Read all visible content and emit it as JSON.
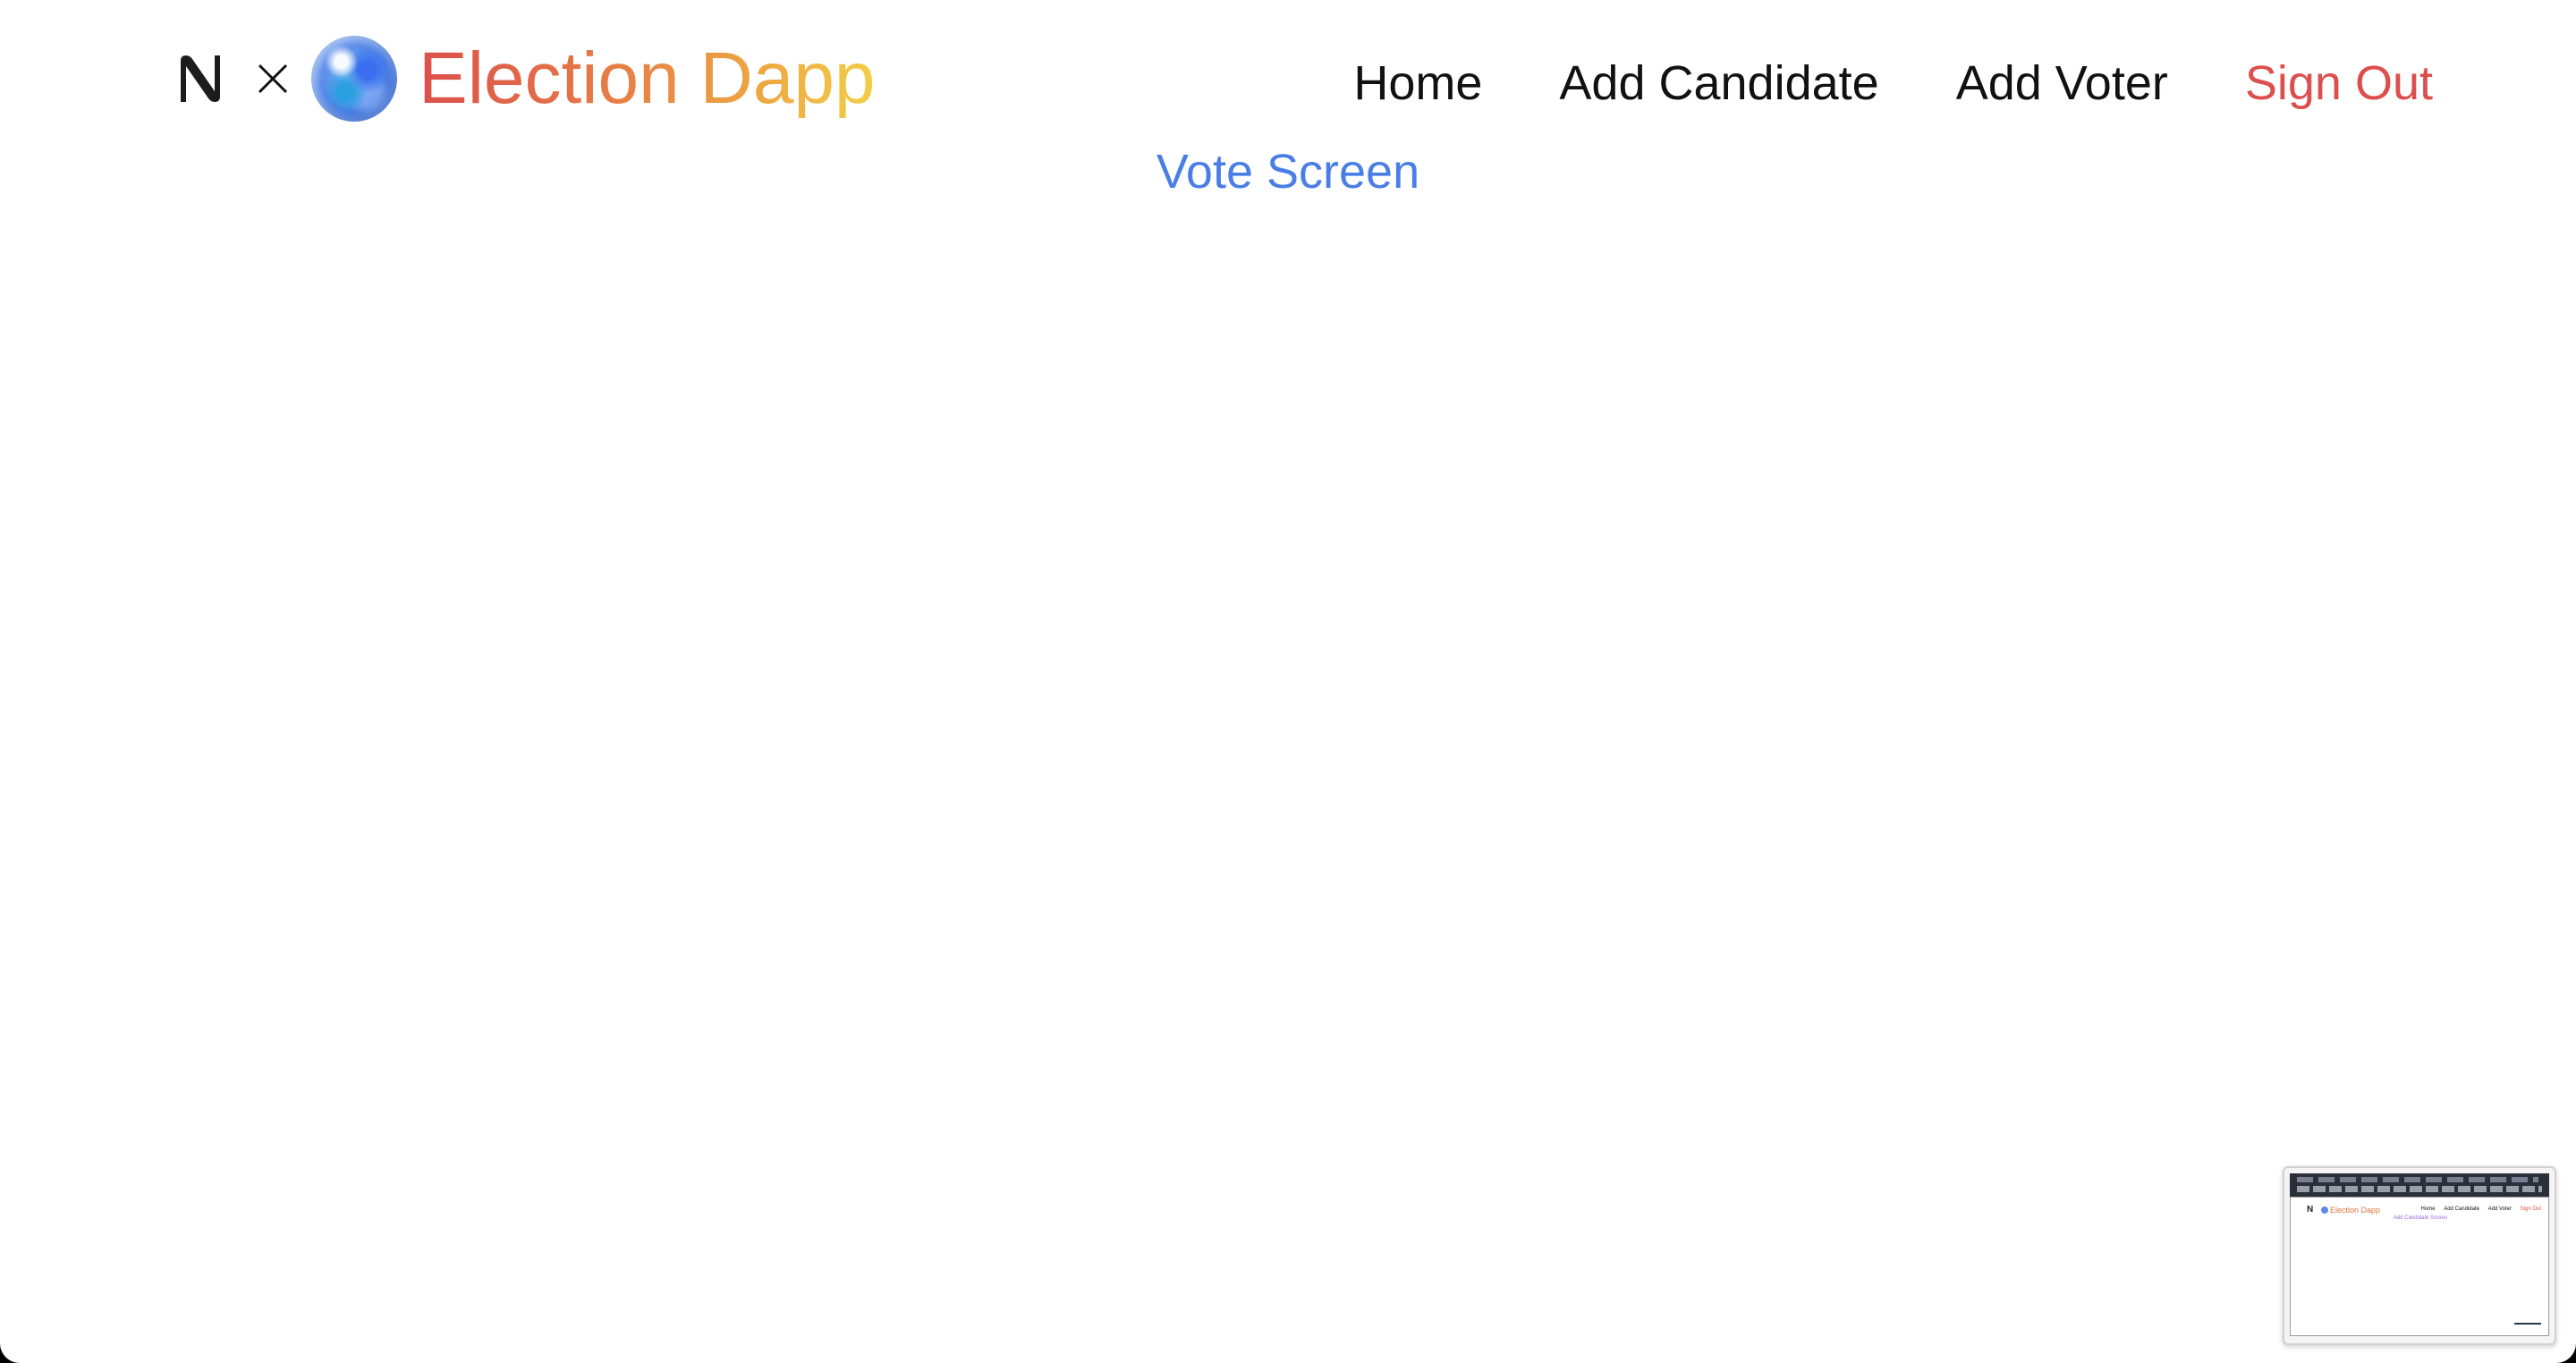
{
  "brand": {
    "logo_icon": "near-protocol-logo-icon",
    "separator_icon": "times-icon",
    "orb_icon": "blue-swirl-orb-icon",
    "title": "Election Dapp",
    "gradient_colors": [
      "#dc4f4c",
      "#e57a45",
      "#eea742",
      "#f2cf48"
    ]
  },
  "nav": {
    "items": [
      {
        "label": "Home"
      },
      {
        "label": "Add Candidate"
      },
      {
        "label": "Add Voter"
      },
      {
        "label": "Sign Out",
        "color": "#dc4f4c"
      }
    ]
  },
  "page": {
    "subtitle": "Vote Screen",
    "subtitle_color": "#4a7ee6"
  },
  "thumbnail": {
    "brand": "Election Dapp",
    "nav": [
      "Home",
      "Add Candidate",
      "Add Voter",
      "Sign Out"
    ],
    "subtitle": "Add Candidate Screen"
  }
}
